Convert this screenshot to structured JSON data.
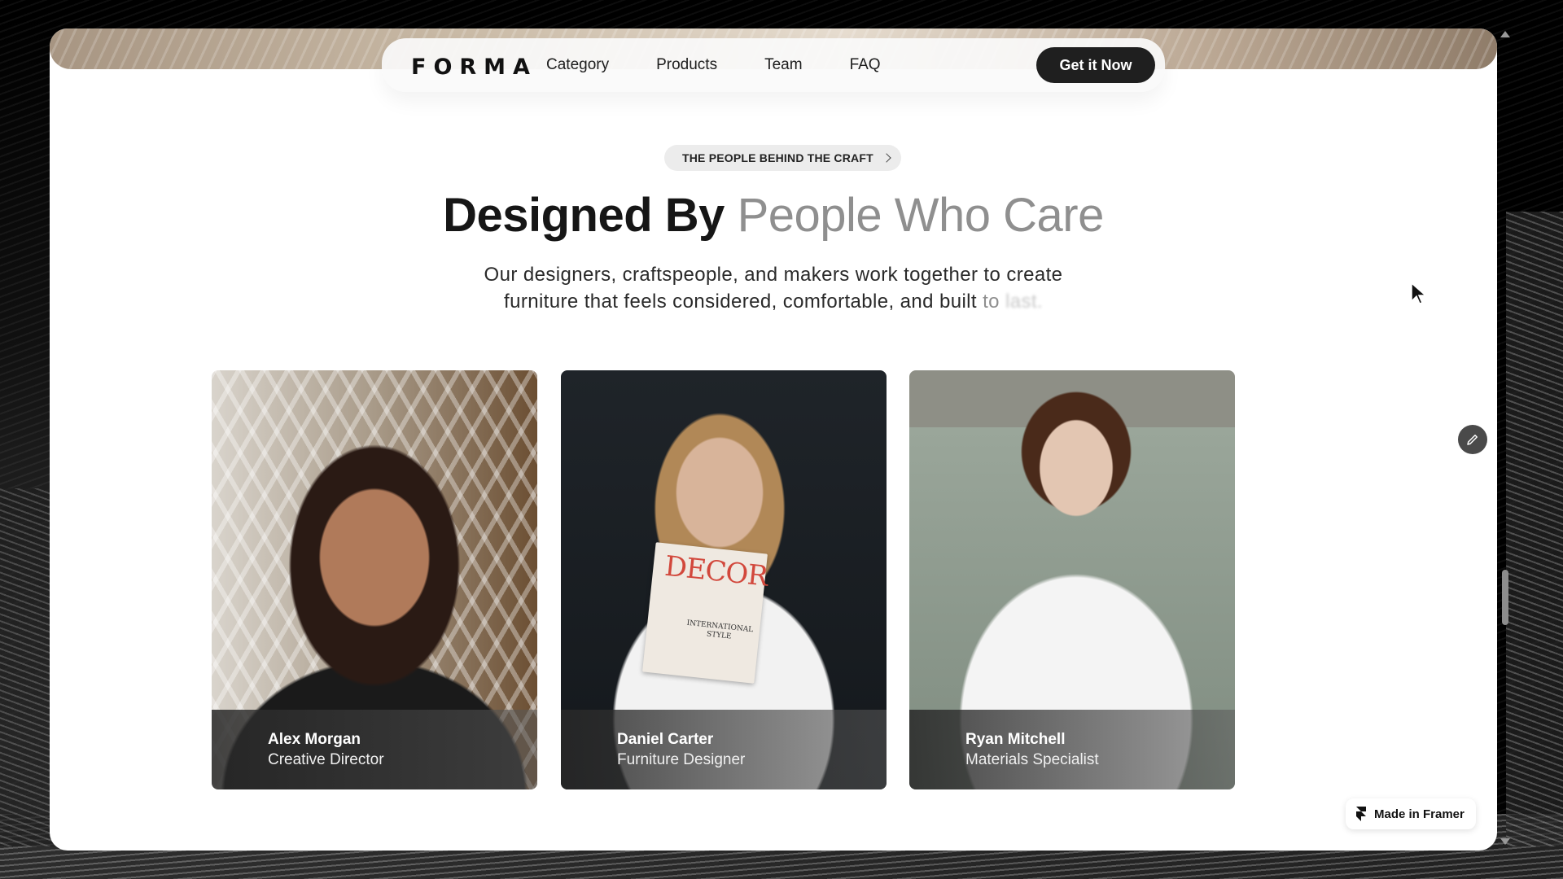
{
  "brand": {
    "logo": "FORMA"
  },
  "nav": {
    "links": [
      "Category",
      "Products",
      "Team",
      "FAQ"
    ],
    "cta_label": "Get it Now"
  },
  "section": {
    "eyebrow": "THE PEOPLE BEHIND THE CRAFT",
    "headline_strong": "Designed By",
    "headline_muted": "People Who Care",
    "subtext_line1": "Our designers, craftspeople, and makers work together to create",
    "subtext_line2_main": "furniture that feels considered, comfortable, and built",
    "subtext_line2_fade1": "to",
    "subtext_line2_fade2": "last."
  },
  "team": [
    {
      "name": "Alex Morgan",
      "role": "Creative Director"
    },
    {
      "name": "Daniel Carter",
      "role": "Furniture Designer"
    },
    {
      "name": "Ryan Mitchell",
      "role": "Materials Specialist"
    }
  ],
  "magazine": {
    "title": "DECOR",
    "subtitle": "INTERNATIONAL STYLE"
  },
  "badge": {
    "label": "Made in Framer"
  },
  "icons": {
    "edit": "pencil-icon",
    "framer": "framer-logo-icon",
    "pill_chevron": "chevron-right-icon",
    "cursor": "mouse-pointer-icon"
  },
  "colors": {
    "cta_bg": "#1f1f1f",
    "headline_muted": "#8f8f8f",
    "page_bg": "#ffffff"
  }
}
